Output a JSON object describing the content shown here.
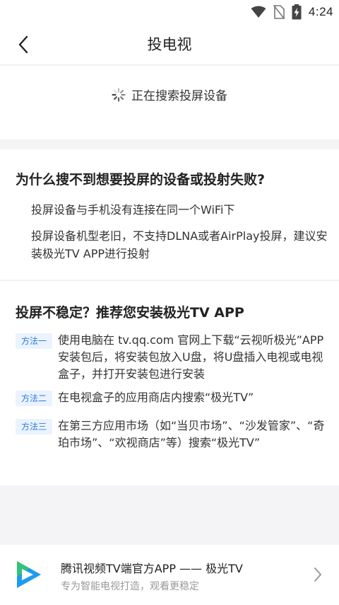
{
  "status_bar": {
    "time": "4:24",
    "icons": [
      "wifi-icon",
      "no-sim-icon",
      "battery-charging-icon"
    ]
  },
  "nav": {
    "back_icon": "chevron-left-icon",
    "title": "投电视"
  },
  "search": {
    "status_text": "正在搜索投屏设备",
    "spinner_icon": "loading-spinner-icon"
  },
  "troubleshoot": {
    "title": "为什么搜不到想要投屏的设备或投射失败?",
    "reasons": [
      "投屏设备与手机没有连接在同一个WiFi下",
      "投屏设备机型老旧，不支持DLNA或者AirPlay投屏，建议安装极光TV APP进行投射"
    ]
  },
  "unstable": {
    "title": "投屏不稳定？推荐您安装极光TV APP",
    "methods": [
      {
        "tag": "方法一",
        "text": "使用电脑在 tv.qq.com 官网上下载“云视听极光”APP安装包后，将安装包放入U盘，将U盘插入电视或电视盒子，并打开安装包进行安装"
      },
      {
        "tag": "方法二",
        "text": "在电视盒子的应用商店内搜索“极光TV”"
      },
      {
        "tag": "方法三",
        "text": "在第三方应用市场（如“当贝市场”、“沙发管家”、“奇珀市场”、“欢视商店”等）搜索“极光TV”"
      }
    ]
  },
  "banner": {
    "logo_icon": "tencent-video-logo-icon",
    "title": "腾讯视频TV端官方APP —— 极光TV",
    "subtitle": "专为智能电视打造，观看更稳定",
    "arrow_icon": "chevron-right-icon"
  },
  "colors": {
    "accent": "#2b7be5",
    "tag_bg": "#eaf3ff",
    "page_bg": "#f4f4f6"
  }
}
